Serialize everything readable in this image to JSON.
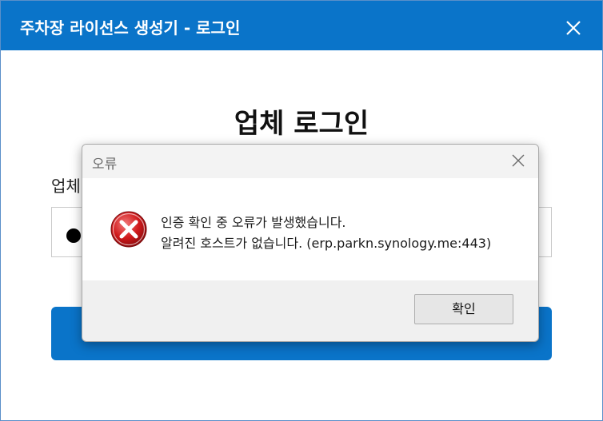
{
  "window": {
    "title": "주차장 라이선스 생성기 - 로그인",
    "heading": "업체 로그인",
    "field_label": "업체",
    "brand_color": "#0a74c9"
  },
  "dialog": {
    "title": "오류",
    "message_line1": "인증 확인 중 오류가 발생했습니다.",
    "message_line2": "알려진 호스트가 없습니다. (erp.parkn.synology.me:443)",
    "ok_label": "확인",
    "icon": "error-icon"
  }
}
